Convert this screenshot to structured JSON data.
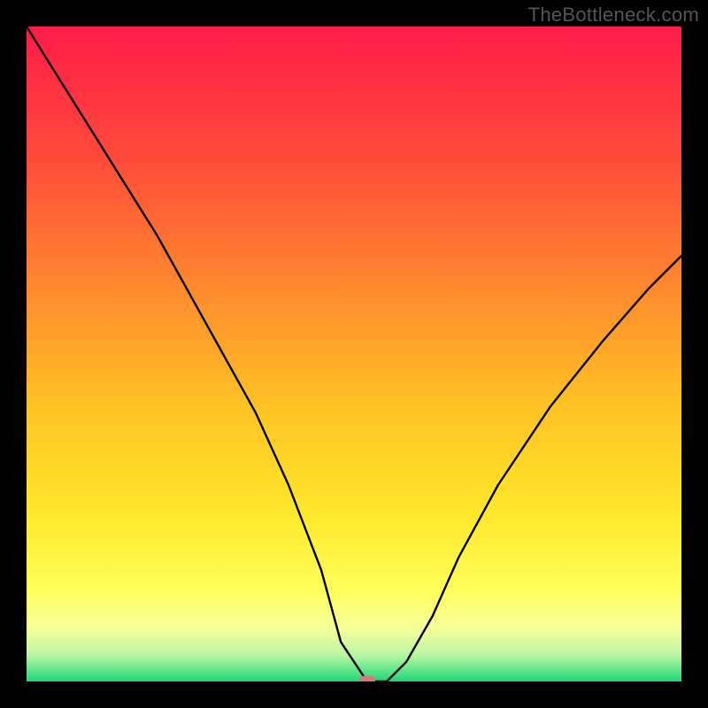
{
  "watermark": "TheBottleneck.com",
  "chart_data": {
    "type": "line",
    "title": "",
    "xlabel": "",
    "ylabel": "",
    "xlim": [
      0,
      100
    ],
    "ylim": [
      0,
      100
    ],
    "grid": false,
    "series": [
      {
        "name": "bottleneck-curve",
        "x": [
          0,
          5,
          10,
          15,
          20,
          25,
          30,
          35,
          40,
          45,
          48,
          52,
          55,
          58,
          62,
          66,
          72,
          80,
          88,
          95,
          100
        ],
        "values": [
          100,
          92,
          84,
          76,
          68,
          59,
          50,
          41,
          30,
          17,
          6,
          0,
          0,
          3,
          10,
          19,
          30,
          42,
          52,
          60,
          65
        ]
      }
    ],
    "marker": {
      "x": 52,
      "y": 0,
      "color": "#d7787a",
      "shape": "pill"
    },
    "background_gradient": {
      "stops": [
        {
          "pos": 0.0,
          "color": "#ff1c48"
        },
        {
          "pos": 0.2,
          "color": "#ff4a3a"
        },
        {
          "pos": 0.4,
          "color": "#ff8a2e"
        },
        {
          "pos": 0.58,
          "color": "#ffc224"
        },
        {
          "pos": 0.74,
          "color": "#ffe72a"
        },
        {
          "pos": 0.86,
          "color": "#ffff5a"
        },
        {
          "pos": 0.92,
          "color": "#f5ff9a"
        },
        {
          "pos": 0.96,
          "color": "#b8f7a4"
        },
        {
          "pos": 1.0,
          "color": "#1ed777"
        }
      ]
    }
  }
}
